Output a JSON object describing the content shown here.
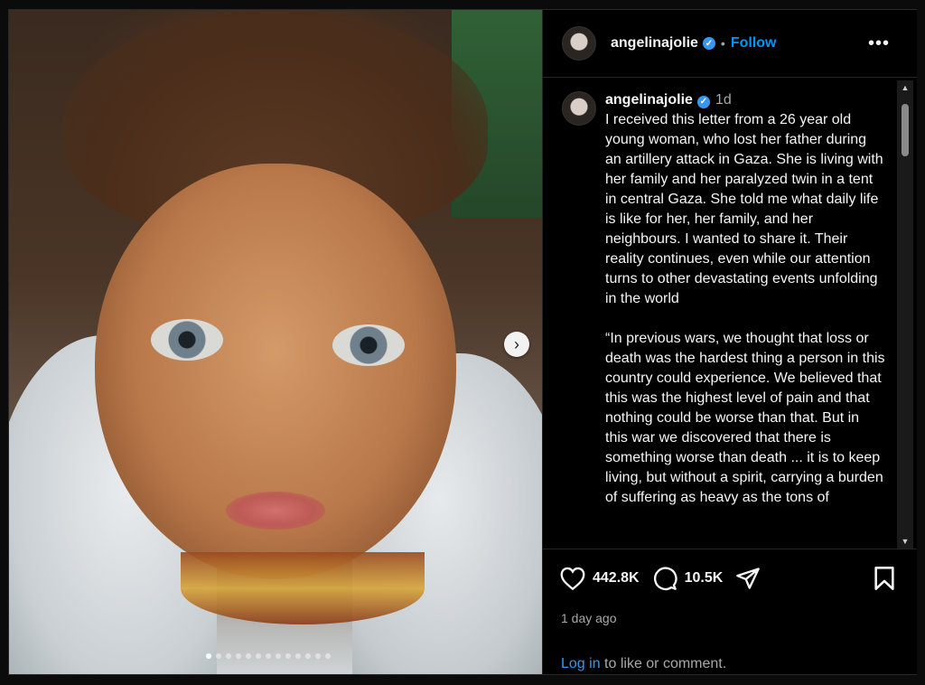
{
  "post": {
    "username": "angelinajolie",
    "follow_label": "Follow",
    "more_icon": "more-horizontal-icon",
    "caption_time": "1d",
    "caption_paragraphs": [
      "I received this letter from a 26 year old young woman, who lost her father during an artillery attack in Gaza. She is living with her family and her paralyzed twin in a tent in central Gaza. She told me what daily life is like for her, her family, and her neighbours. I wanted to share it. Their reality continues, even while our attention turns to other devastating events unfolding in the world",
      "“In previous wars, we thought that loss or death was the hardest thing a person in this country could experience. We believed that this was the highest level of pain and that nothing could be worse than that. But in this war we discovered that there is something worse than death ... it is to keep living, but without a spirit, carrying a burden of suffering as heavy as the tons of"
    ],
    "likes": "442.8K",
    "comments": "10.5K",
    "posted_ago": "1 day ago",
    "login_link": "Log in",
    "login_rest": " to like or comment."
  },
  "carousel": {
    "total_slides": 13,
    "active_index": 0
  },
  "colors": {
    "accent": "#0095f6",
    "verified": "#3797f0",
    "background": "#000000",
    "muted_text": "#a8a8a8"
  }
}
